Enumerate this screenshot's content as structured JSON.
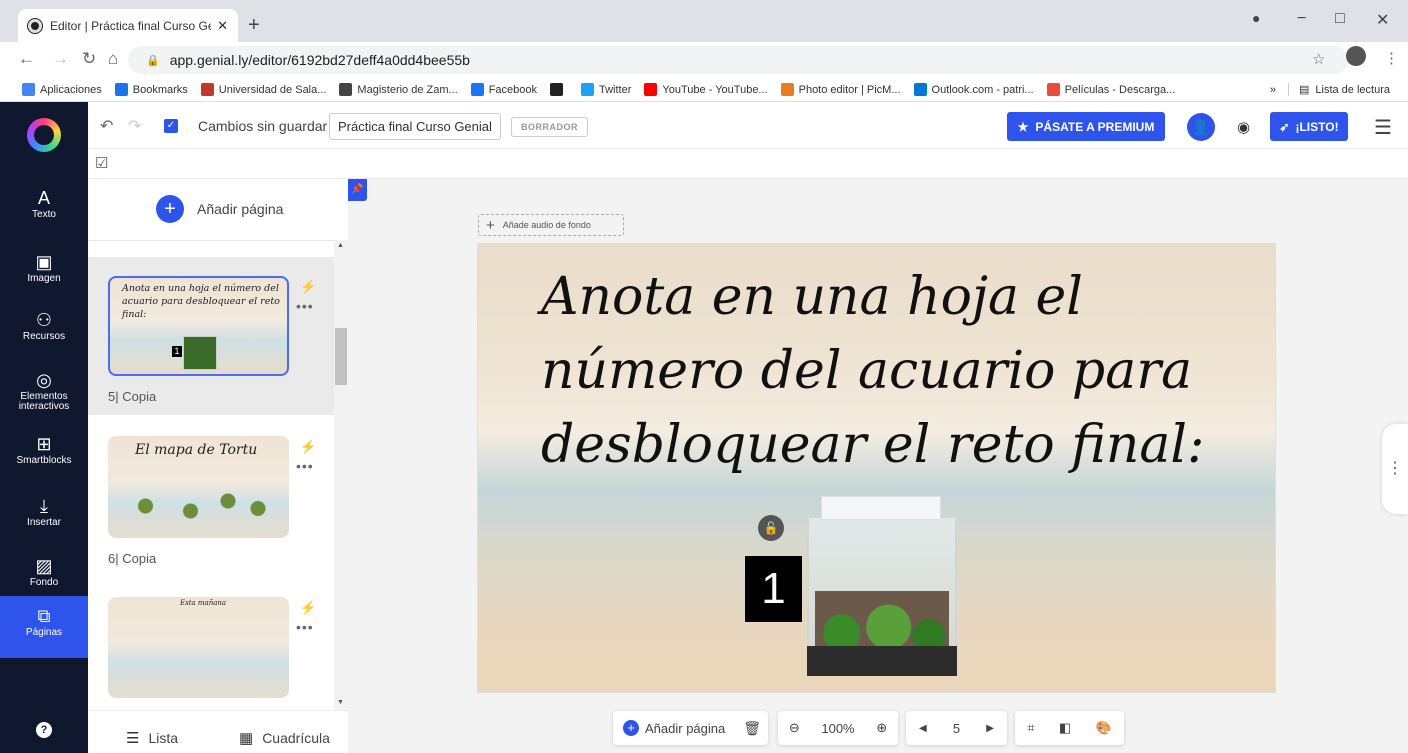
{
  "browser": {
    "tab_title": "Editor | Práctica final Curso Genial",
    "url": "app.genial.ly/editor/6192bd27deff4a0dd4bee55b",
    "bookmarks": [
      {
        "label": "Aplicaciones",
        "color": "#4285f4"
      },
      {
        "label": "Bookmarks",
        "color": "#1a73e8"
      },
      {
        "label": "Universidad de Sala...",
        "color": "#c0392b"
      },
      {
        "label": "Magisterio de Zam...",
        "color": "#444444"
      },
      {
        "label": "Facebook",
        "color": "#1877f2"
      },
      {
        "label": "",
        "color": "#222222"
      },
      {
        "label": "Twitter",
        "color": "#1da1f2"
      },
      {
        "label": "YouTube - YouTube...",
        "color": "#ff0000"
      },
      {
        "label": "Photo editor | PicM...",
        "color": "#e67e22"
      },
      {
        "label": "Outlook.com - patri...",
        "color": "#0078d4"
      },
      {
        "label": "Películas - Descarga...",
        "color": "#e74c3c"
      }
    ],
    "more_bookmarks": "»",
    "reading_list": "Lista de lectura"
  },
  "rail": {
    "items": [
      {
        "label": "Texto",
        "icon": "A"
      },
      {
        "label": "Imagen",
        "icon": "▣"
      },
      {
        "label": "Recursos",
        "icon": "⚇"
      },
      {
        "label": "Elementos interactivos",
        "icon": "◎"
      },
      {
        "label": "Smartblocks",
        "icon": "⊞"
      },
      {
        "label": "Insertar",
        "icon": "⤓"
      },
      {
        "label": "Fondo",
        "icon": "▨"
      },
      {
        "label": "Páginas",
        "icon": "⧉"
      }
    ],
    "help": "?"
  },
  "toolbar": {
    "status": "Cambios sin guardar",
    "title": "Práctica final Curso Genial",
    "draft": "BORRADOR",
    "premium": "PÁSATE A PREMIUM",
    "ready": "¡LISTO!"
  },
  "panel": {
    "add_page": "Añadir página",
    "pages": [
      {
        "name": "5| Copia",
        "thumb_text": "Anota  en una hoja el número del acuario para desbloquear el reto final:"
      },
      {
        "name": "6| Copia",
        "thumb_text": "El mapa de Tortu"
      },
      {
        "name": "",
        "thumb_text": "Esta mañana"
      }
    ],
    "view_list": "Lista",
    "view_grid": "Cuadrícula"
  },
  "canvas": {
    "audio": "Añade audio de fondo",
    "slide_text": "Anota  en una hoja el número del acuario para desbloquear el reto final:",
    "number": "1"
  },
  "bottom": {
    "add_page": "Añadir página",
    "zoom": "100%",
    "page": "5"
  },
  "colors": {
    "accent": "#2f54eb",
    "rail": "#101830"
  }
}
